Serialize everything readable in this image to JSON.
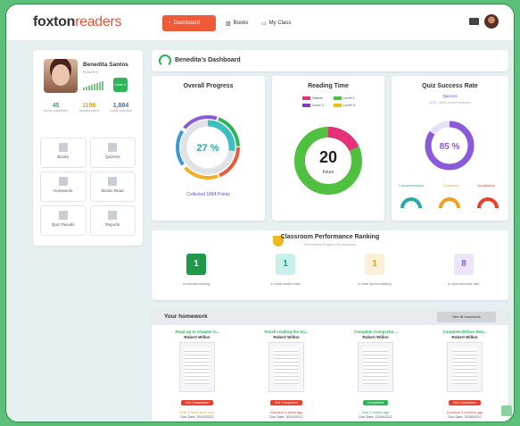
{
  "app": {
    "logo_main": "foxton",
    "logo_accent": "readers"
  },
  "nav": {
    "dashboard": "Dashboard",
    "books": "Books",
    "my_class": "My Class"
  },
  "profile": {
    "name": "Benedita Santos",
    "role": "Readers",
    "level_badge": "Level 1",
    "stats": [
      {
        "value": "45",
        "label": "books completed",
        "color": "#2fb45a"
      },
      {
        "value": "1198",
        "label": "minutes spent",
        "color": "#f0a020"
      },
      {
        "value": "1,884",
        "label": "points collected",
        "color": "#3a6fd8"
      }
    ],
    "tiles": [
      "Books",
      "Quizzes",
      "Homework",
      "Books Read",
      "Quiz Results",
      "Reports"
    ]
  },
  "dashboard_title": "Benedita's Dashboard",
  "overall": {
    "title": "Overall Progress",
    "percent": "27 %",
    "collected": "Collected 1884 Points"
  },
  "reading": {
    "title": "Reading Time",
    "value": "20",
    "unit": "hours",
    "legend": [
      {
        "label": "Starter",
        "color": "#e8307a"
      },
      {
        "label": "Level 1",
        "color": "#4fc040"
      },
      {
        "label": "Level 2",
        "color": "#8a3ab8"
      },
      {
        "label": "Level 3",
        "color": "#e8c020"
      }
    ]
  },
  "quiz": {
    "title": "Quiz Success Rate",
    "sub": "Quizzes",
    "sub2": "2475 / 2895 correct answers",
    "percent": "85 %",
    "skills": [
      "Comprehension",
      "Grammar",
      "Vocabulary"
    ]
  },
  "ranking": {
    "title": "Classroom Performance Ranking",
    "sub": "Elementary English (15 students)",
    "items": [
      {
        "rank": "1",
        "label": "in overall ranking",
        "bg": "#1f9a4a",
        "fg": "#fff"
      },
      {
        "rank": "1",
        "label": "in total books read",
        "bg": "#c9f1ec",
        "fg": "#1f9a8a"
      },
      {
        "rank": "1",
        "label": "in time spent reading",
        "bg": "#fdf0d8",
        "fg": "#e8a020"
      },
      {
        "rank": "8",
        "label": "in quiz success rate",
        "bg": "#ece6fb",
        "fg": "#8a5ad8"
      }
    ]
  },
  "homework": {
    "title": "Your homework",
    "see_all": "See all homework",
    "items": [
      {
        "title": "Read up to Chapter 5...",
        "author": "Robert Willon",
        "status": "Not Completed",
        "status_color": "#e8402a",
        "due": "Due 1 week from now",
        "due_color": "#f0a020",
        "date": "Due Date: 30/10/2022"
      },
      {
        "title": "Finish reading the bo...",
        "author": "Robert Willon",
        "status": "Not Completed",
        "status_color": "#e8402a",
        "due": "Overdue 1 week ago",
        "due_color": "#e8402a",
        "date": "Due Date: 30/10/2022"
      },
      {
        "title": "Complete Comprehe...",
        "author": "Robert Willon",
        "status": "Completed",
        "status_color": "#2fb45a",
        "due": "Due 1 month ago",
        "due_color": "#2fb45a",
        "date": "Due Date: 15/09/2022"
      },
      {
        "title": "Complete Before Rea...",
        "author": "Robert Willon",
        "status": "Not Completed",
        "status_color": "#e8402a",
        "due": "Overdue 2 months ago",
        "due_color": "#e8402a",
        "date": "Due Date: 30/08/2022"
      }
    ]
  }
}
